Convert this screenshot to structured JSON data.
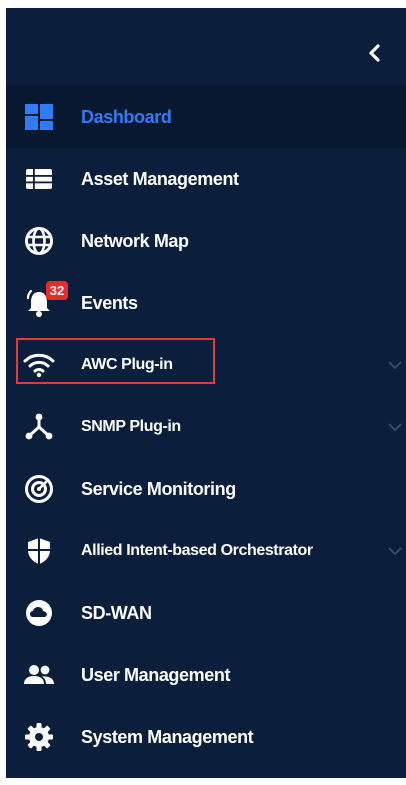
{
  "sidebar": {
    "collapse_icon": "chevron-left-icon",
    "items": [
      {
        "label": "Dashboard",
        "icon": "dashboard-icon",
        "active": true
      },
      {
        "label": "Asset Management",
        "icon": "list-icon"
      },
      {
        "label": "Network Map",
        "icon": "globe-icon"
      },
      {
        "label": "Events",
        "icon": "bell-icon",
        "badge": "32"
      },
      {
        "label": "AWC Plug-in",
        "icon": "wifi-icon",
        "expandable": true,
        "highlighted": true
      },
      {
        "label": "SNMP Plug-in",
        "icon": "network-hub-icon",
        "expandable": true
      },
      {
        "label": "Service Monitoring",
        "icon": "radar-icon"
      },
      {
        "label": "Allied Intent-based Orchestrator",
        "icon": "shield-icon",
        "expandable": true
      },
      {
        "label": "SD-WAN",
        "icon": "cloud-icon"
      },
      {
        "label": "User Management",
        "icon": "users-icon"
      },
      {
        "label": "System Management",
        "icon": "gear-icon"
      }
    ]
  },
  "colors": {
    "sidebar_bg": "#0b1f3d",
    "active_bg": "#081830",
    "active_text": "#2f7cf6",
    "text": "#ffffff",
    "badge": "#e52b2b",
    "highlight_border": "#e53935",
    "chevron": "#3b4f6e"
  }
}
